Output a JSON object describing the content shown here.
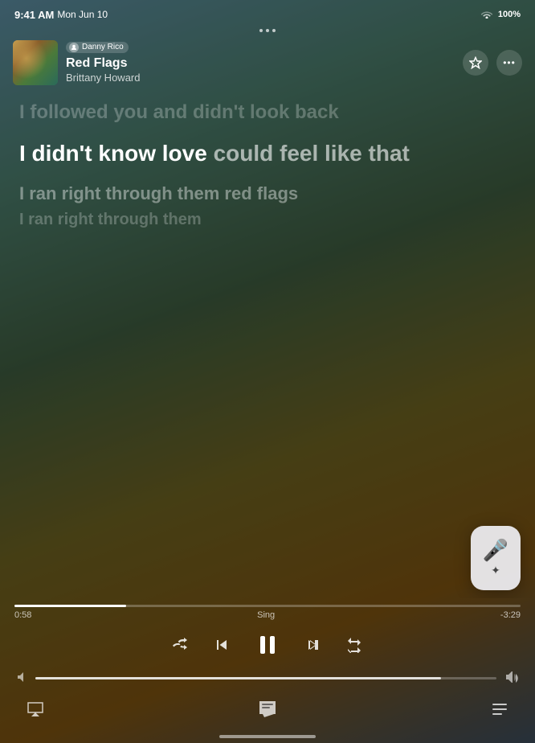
{
  "statusBar": {
    "time": "9:41 AM",
    "date": "Mon Jun 10",
    "wifi": "WiFi",
    "battery": "100%"
  },
  "header": {
    "userBadge": "Danny Rico",
    "trackTitle": "Red Flags",
    "artist": "Brittany Howard",
    "starBtnLabel": "Add to favorites",
    "moreBtnLabel": "More options"
  },
  "lyrics": {
    "line1": "I followed you and didn't look back",
    "line2_part1": "I didn't know love ",
    "line2_part2": "could feel like that",
    "line3": "I ran right through them red flags",
    "line4": "I ran right through them"
  },
  "progress": {
    "current": "0:58",
    "label": "Sing",
    "remaining": "-3:29",
    "fillPercent": 22
  },
  "controls": {
    "shuffleLabel": "Shuffle",
    "rewindLabel": "Rewind",
    "playPauseLabel": "Pause",
    "forwardLabel": "Fast Forward",
    "repeatLabel": "Repeat"
  },
  "volume": {
    "fillPercent": 88
  },
  "bottomBar": {
    "airplayLabel": "AirPlay",
    "lyricsLabel": "Lyrics",
    "queueLabel": "Queue"
  },
  "karaokeBtn": {
    "label": "Sing mode"
  },
  "icons": {
    "shuffle": "⇄",
    "rewind": "⏮",
    "pause": "⏸",
    "forward": "⏭",
    "repeat": "↺",
    "volumeLow": "🔈",
    "volumeHigh": "🔊",
    "airplay": "⊙",
    "lyrics": "💬",
    "queue": "≡",
    "star": "☆",
    "more": "•••",
    "mic": "🎤"
  }
}
